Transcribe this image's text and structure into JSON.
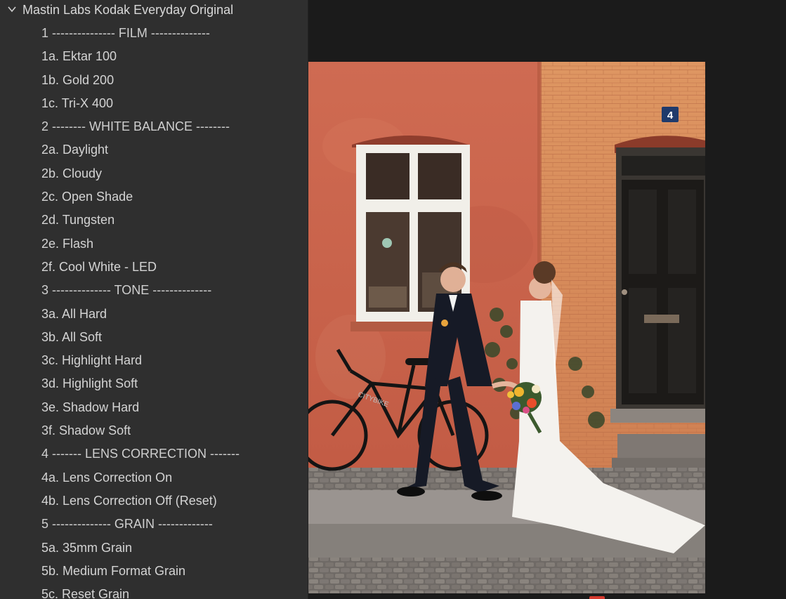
{
  "panel": {
    "group_title": "Mastin Labs Kodak Everyday Original",
    "items": [
      {
        "label": "1 --------------- FILM --------------",
        "divider": true
      },
      {
        "label": "1a. Ektar 100"
      },
      {
        "label": "1b. Gold 200"
      },
      {
        "label": "1c. Tri-X 400"
      },
      {
        "label": "2 -------- WHITE BALANCE --------",
        "divider": true
      },
      {
        "label": "2a. Daylight"
      },
      {
        "label": "2b. Cloudy"
      },
      {
        "label": "2c. Open Shade"
      },
      {
        "label": "2d. Tungsten"
      },
      {
        "label": "2e. Flash"
      },
      {
        "label": "2f. Cool White - LED"
      },
      {
        "label": "3 -------------- TONE --------------",
        "divider": true
      },
      {
        "label": "3a. All Hard"
      },
      {
        "label": "3b. All Soft"
      },
      {
        "label": "3c. Highlight Hard"
      },
      {
        "label": "3d. Highlight Soft"
      },
      {
        "label": "3e. Shadow Hard"
      },
      {
        "label": "3f. Shadow Soft"
      },
      {
        "label": "4 ------- LENS CORRECTION -------",
        "divider": true
      },
      {
        "label": "4a. Lens Correction On"
      },
      {
        "label": "4b. Lens Correction Off (Reset)"
      },
      {
        "label": "5 -------------- GRAIN -------------",
        "divider": true
      },
      {
        "label": "5a. 35mm Grain"
      },
      {
        "label": "5b. Medium Format Grain"
      },
      {
        "label": "5c. Reset Grain"
      }
    ]
  },
  "photo": {
    "house_number": "4",
    "bike_text": "CITYBIKE"
  },
  "colors": {
    "panel_bg": "#2f2f2f",
    "preview_bg": "#1b1b1b",
    "red_wall": "#c8644a",
    "orange_wall": "#d98a58",
    "door": "#1c1a18",
    "accent_marker": "#d63a2f"
  }
}
